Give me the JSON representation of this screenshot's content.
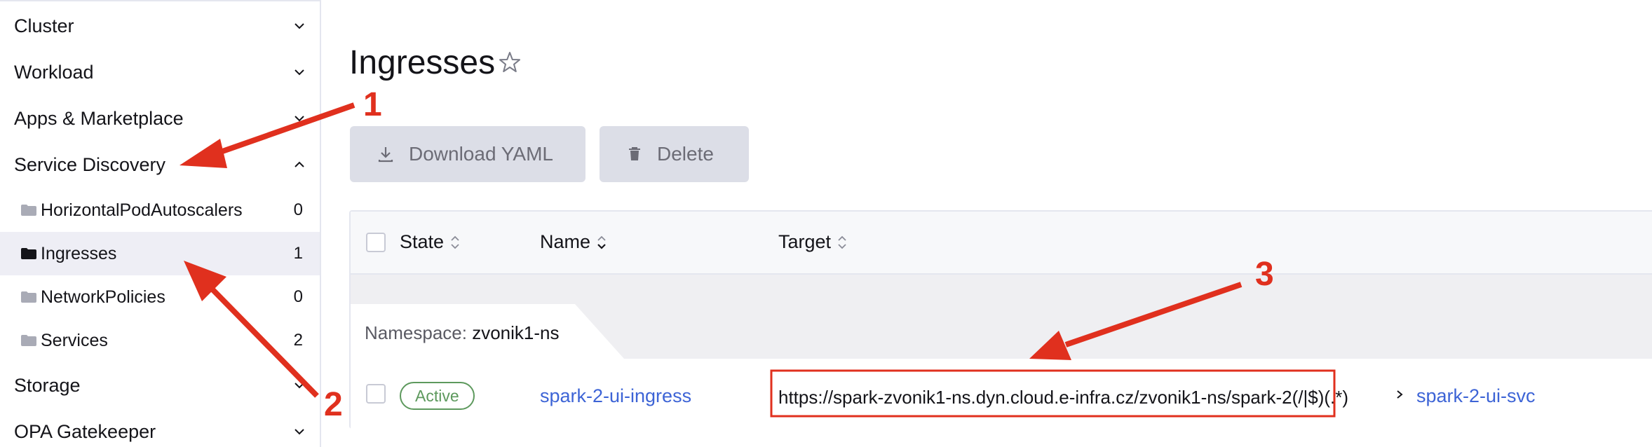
{
  "sidebar": {
    "groups": {
      "cluster": "Cluster",
      "workload": "Workload",
      "apps": "Apps & Marketplace",
      "service_discovery": "Service Discovery",
      "storage": "Storage",
      "opa": "OPA Gatekeeper"
    },
    "items": [
      {
        "label": "HorizontalPodAutoscalers",
        "count": "0"
      },
      {
        "label": "Ingresses",
        "count": "1"
      },
      {
        "label": "NetworkPolicies",
        "count": "0"
      },
      {
        "label": "Services",
        "count": "2"
      }
    ]
  },
  "page": {
    "title": "Ingresses"
  },
  "toolbar": {
    "download_label": "Download YAML",
    "delete_label": "Delete"
  },
  "table": {
    "headers": {
      "state": "State",
      "name": "Name",
      "target": "Target"
    },
    "namespace_label": "Namespace:",
    "namespace_value": "zvonik1-ns",
    "rows": [
      {
        "state": "Active",
        "name": "spark-2-ui-ingress",
        "target": "https://spark-zvonik1-ns.dyn.cloud.e-infra.cz/zvonik1-ns/spark-2(/|$)(.*)",
        "service": "spark-2-ui-svc"
      }
    ]
  },
  "annotations": [
    "1",
    "2",
    "3"
  ],
  "colors": {
    "accent_link": "#3d64d6",
    "active_badge": "#5d995d",
    "annotation_red": "#e0301e",
    "button_bg": "#dcdee7",
    "selected_bg": "#eeeef5"
  }
}
